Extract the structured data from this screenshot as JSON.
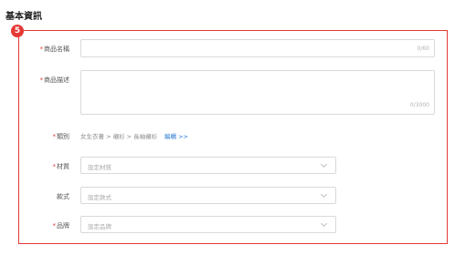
{
  "section": {
    "title": "基本資訊",
    "step_badge": "5"
  },
  "product_name": {
    "label": "商品名稱",
    "required_mark": "*",
    "counter": "0/60"
  },
  "product_description": {
    "label": "商品描述",
    "required_mark": "*",
    "counter": "0/3000"
  },
  "category": {
    "label": "類別",
    "required_mark": "*",
    "path": "女生衣著 > 襯衫 > 長袖襯衫",
    "edit_link": "編輯 >>"
  },
  "material": {
    "label": "材質",
    "required_mark": "*",
    "placeholder": "設定材質"
  },
  "style": {
    "label": "款式",
    "placeholder": "設定款式"
  },
  "brand": {
    "label": "品牌",
    "required_mark": "*",
    "placeholder": "設定品牌"
  },
  "icons": {
    "dropdown": "chevron-down-icon",
    "badge": "number-badge"
  },
  "colors": {
    "highlight": "#e53935",
    "link": "#2b7bd6",
    "required": "#e53935"
  }
}
